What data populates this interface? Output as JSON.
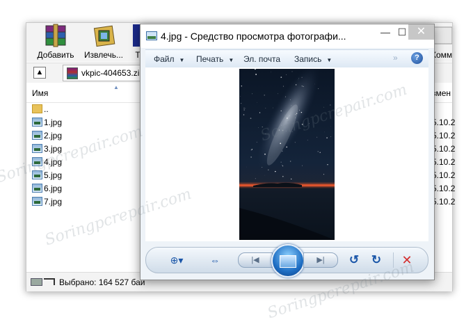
{
  "rar": {
    "toolbar": [
      {
        "label": "Добавить",
        "icon": "winrar-books-icon"
      },
      {
        "label": "Извлечь...",
        "icon": "extract-folder-icon"
      },
      {
        "label": "Т",
        "icon": "test-icon"
      },
      {
        "label": "Комм",
        "icon": "comment-icon"
      }
    ],
    "path": "vkpic-404653.zi",
    "up_icon": "up-folder-icon",
    "columns": {
      "name": "Имя",
      "date": "змен"
    },
    "files": [
      {
        "name": "..",
        "date": "",
        "type": "folder"
      },
      {
        "name": "1.jpg",
        "date": "5.10.2",
        "type": "image"
      },
      {
        "name": "2.jpg",
        "date": "5.10.2",
        "type": "image"
      },
      {
        "name": "3.jpg",
        "date": "5.10.2",
        "type": "image"
      },
      {
        "name": "4.jpg",
        "date": "5.10.2",
        "type": "image"
      },
      {
        "name": "5.jpg",
        "date": "5.10.2",
        "type": "image"
      },
      {
        "name": "6.jpg",
        "date": "5.10.2",
        "type": "image"
      },
      {
        "name": "7.jpg",
        "date": "5.10.2",
        "type": "image"
      }
    ],
    "status": "Выбрано: 164 527 бай"
  },
  "viewer": {
    "title": "4.jpg - Средство просмотра фотографи...",
    "window_buttons": {
      "minimize": "—",
      "maximize": "☐",
      "close": "✕"
    },
    "menu": [
      {
        "label": "Файл"
      },
      {
        "label": "Печать"
      },
      {
        "label": "Эл. почта"
      },
      {
        "label": "Запись"
      }
    ],
    "menu_more": "»",
    "help": "?",
    "controls": {
      "zoom": "⊕▾",
      "fit": "⇔",
      "prev": "|◀",
      "next": "▶|",
      "rotate_left": "↺",
      "rotate_right": "↻",
      "delete": "✕"
    }
  },
  "watermark": "Soringpcrepair.com",
  "colors": {
    "accent": "#1a56a8",
    "delete": "#d42d2d",
    "horizon": "#e0542e"
  }
}
